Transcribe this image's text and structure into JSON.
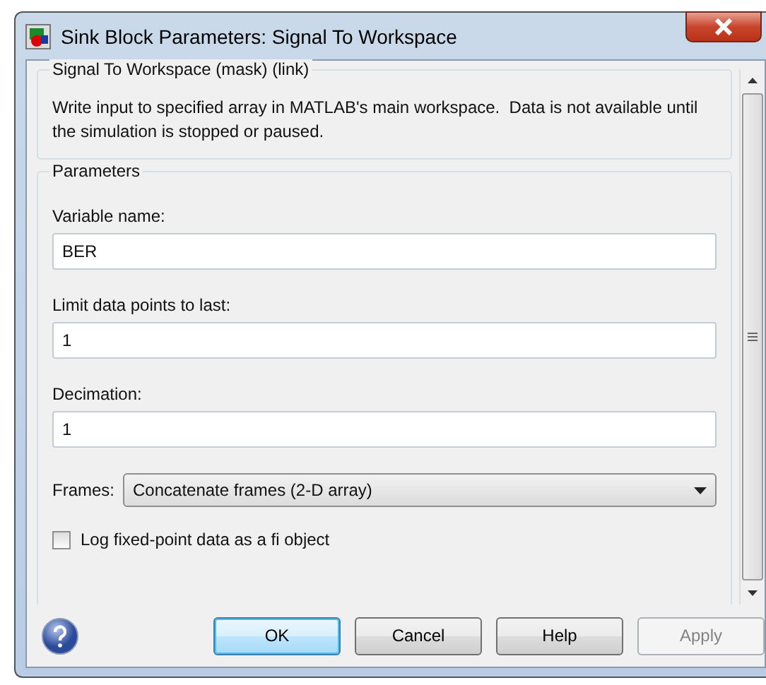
{
  "window": {
    "title": "Sink Block Parameters: Signal To Workspace"
  },
  "description": {
    "title": "Signal To Workspace (mask) (link)",
    "text": "Write input to specified array in MATLAB's main workspace.  Data is not available until the simulation is stopped or paused."
  },
  "parameters": {
    "title": "Parameters",
    "fields": [
      {
        "kind": "text",
        "label": "Variable name:",
        "value": "BER"
      },
      {
        "kind": "text",
        "label": "Limit data points to last:",
        "value": "1"
      },
      {
        "kind": "text",
        "label": "Decimation:",
        "value": "1"
      },
      {
        "kind": "select",
        "label": "Frames:",
        "value": "Concatenate frames (2-D array)"
      },
      {
        "kind": "checkbox",
        "label": "Log fixed-point data as a fi object",
        "checked": false
      }
    ]
  },
  "buttons": [
    {
      "label": "OK",
      "default": true,
      "disabled": false
    },
    {
      "label": "Cancel",
      "default": false,
      "disabled": false
    },
    {
      "label": "Help",
      "default": false,
      "disabled": false
    },
    {
      "label": "Apply",
      "default": false,
      "disabled": true
    }
  ]
}
